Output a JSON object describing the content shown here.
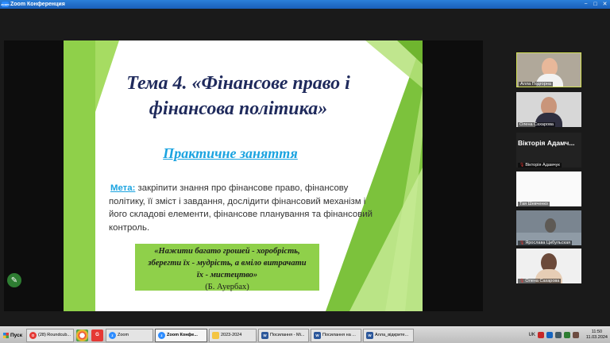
{
  "window": {
    "title": "Zoom Конференция",
    "logo": "zoom",
    "controls": [
      "−",
      "□",
      "✕"
    ]
  },
  "slide": {
    "title_line1": "Тема 4. «Фінансове право і",
    "title_line2": "фінансова політика»",
    "subtitle": "Практичне заняття",
    "goal_label": "Мета:",
    "goal_text": " закріпити знання про фінансове право, фінансову політику, її зміст і завдання, дослідити фінансовий механізм і його складові елементи, фінансове планування та фінансовий контроль.",
    "quote_line1": "«Нажити багато грошей - хоробрість,",
    "quote_line2": "зберегти їх - мудрість, а вміло витрачати",
    "quote_line3": "їх - мистецтво»",
    "quote_author": "(Б. Ауербах)",
    "colors": {
      "green": "#8fd04a",
      "title": "#1f2a5c",
      "accent": "#1aa3e0"
    }
  },
  "annotate_button": {
    "icon": "pencil-icon"
  },
  "participants": [
    {
      "name": "Алла Подгорна",
      "type": "video",
      "active": true,
      "muted": false
    },
    {
      "name": "Олена Сахарова",
      "type": "video",
      "active": false,
      "muted": false
    },
    {
      "name": "Вікторія Адамчук",
      "display": "Вікторія Адамч...",
      "type": "name",
      "muted": true
    },
    {
      "name": "Тая Шевченко",
      "type": "video",
      "muted": false
    },
    {
      "name": "Ярослава Цибульская",
      "type": "video",
      "muted": true
    },
    {
      "name": "Олена Сахарова",
      "type": "video",
      "muted": true
    }
  ],
  "taskbar": {
    "start": "Пуск",
    "buttons": [
      {
        "label": "(28) Roundcub...",
        "icon": "opera-icon"
      },
      {
        "label": "Zoom",
        "icon": "zoom-icon"
      },
      {
        "label": "Zoom Конфе...",
        "icon": "zoom-icon",
        "active": true
      },
      {
        "label": "2023-2024",
        "icon": "folder-icon"
      },
      {
        "label": "Посилання - Mi...",
        "icon": "word-icon"
      },
      {
        "label": "Посилання на ...",
        "icon": "word-icon"
      },
      {
        "label": "Алла_відкрите...",
        "icon": "word-icon"
      }
    ],
    "lang": "UK",
    "time": "11:50",
    "date": "11.03.2024"
  }
}
